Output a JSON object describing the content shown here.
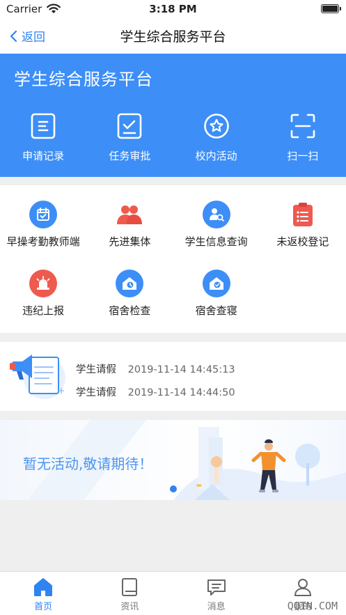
{
  "status_bar": {
    "carrier": "Carrier",
    "time": "3:18 PM"
  },
  "nav": {
    "back_label": "返回",
    "title": "学生综合服务平台"
  },
  "hero": {
    "title": "学生综合服务平台",
    "actions": [
      {
        "label": "申请记录",
        "icon": "application-record-icon"
      },
      {
        "label": "任务审批",
        "icon": "task-approval-icon"
      },
      {
        "label": "校内活动",
        "icon": "campus-activity-icon"
      },
      {
        "label": "扫一扫",
        "icon": "scan-icon"
      }
    ]
  },
  "functions": [
    {
      "label": "早操考勤教师端",
      "icon": "calendar-check-icon",
      "color": "#3d8ef7"
    },
    {
      "label": "先进集体",
      "icon": "group-icon",
      "color": "#ef5a4f"
    },
    {
      "label": "学生信息查询",
      "icon": "user-search-icon",
      "color": "#3d8ef7"
    },
    {
      "label": "未返校登记",
      "icon": "clipboard-list-icon",
      "color": "#ef5a4f"
    },
    {
      "label": "违纪上报",
      "icon": "alarm-light-icon",
      "color": "#ef5a4f"
    },
    {
      "label": "宿舍检查",
      "icon": "dorm-check-icon",
      "color": "#3d8ef7"
    },
    {
      "label": "宿舍查寝",
      "icon": "dorm-inspect-icon",
      "color": "#3d8ef7"
    }
  ],
  "notices": [
    {
      "title": "学生请假",
      "datetime": "2019-11-14 14:45:13"
    },
    {
      "title": "学生请假",
      "datetime": "2019-11-14 14:44:50"
    }
  ],
  "activity": {
    "empty_message": "暂无活动,敬请期待！"
  },
  "tabs": [
    {
      "label": "首页",
      "icon": "home-icon",
      "active": true
    },
    {
      "label": "资讯",
      "icon": "book-icon",
      "active": false
    },
    {
      "label": "消息",
      "icon": "message-icon",
      "active": false
    },
    {
      "label": "我的",
      "icon": "person-icon",
      "active": false
    }
  ],
  "watermark": "QQTN.COM",
  "colors": {
    "primary": "#3d8ef7",
    "accent_red": "#ef5a4f",
    "link": "#2f83f2"
  }
}
